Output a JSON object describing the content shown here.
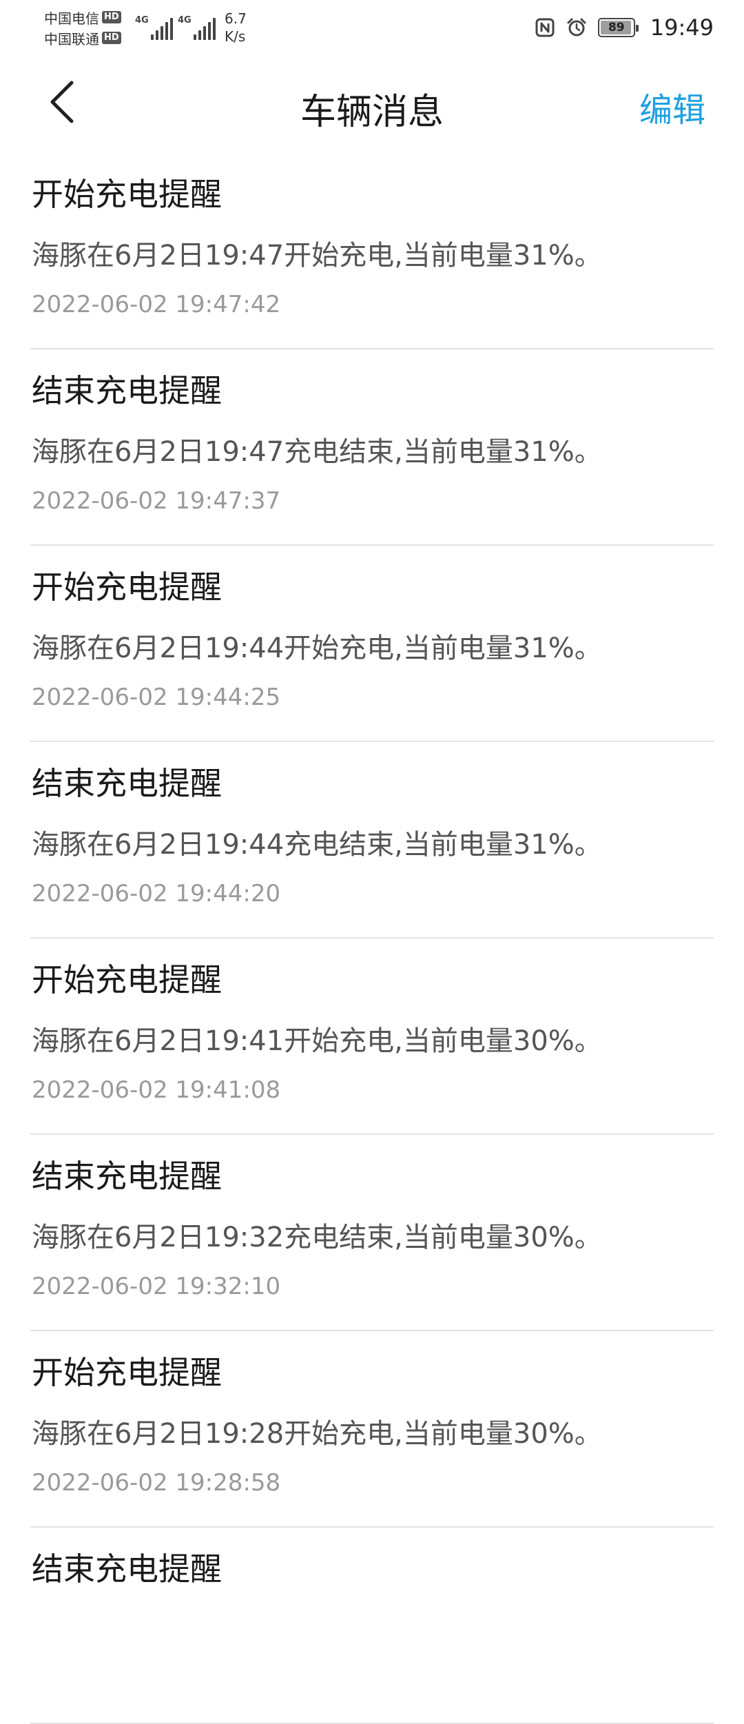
{
  "status_bar": {
    "carrier_1": "中国电信",
    "carrier_2": "中国联通",
    "hd_badge": "HD",
    "network_1": "4G",
    "network_2": "4G",
    "speed_value": "6.7",
    "speed_unit": "K/s",
    "battery_level": "89",
    "time": "19:49"
  },
  "header": {
    "title": "车辆消息",
    "edit_label": "编辑"
  },
  "messages": [
    {
      "title": "开始充电提醒",
      "body": "海豚在6月2日19:47开始充电,当前电量31%。",
      "time": "2022-06-02 19:47:42"
    },
    {
      "title": "结束充电提醒",
      "body": "海豚在6月2日19:47充电结束,当前电量31%。",
      "time": "2022-06-02 19:47:37"
    },
    {
      "title": "开始充电提醒",
      "body": "海豚在6月2日19:44开始充电,当前电量31%。",
      "time": "2022-06-02 19:44:25"
    },
    {
      "title": "结束充电提醒",
      "body": "海豚在6月2日19:44充电结束,当前电量31%。",
      "time": "2022-06-02 19:44:20"
    },
    {
      "title": "开始充电提醒",
      "body": "海豚在6月2日19:41开始充电,当前电量30%。",
      "time": "2022-06-02 19:41:08"
    },
    {
      "title": "结束充电提醒",
      "body": "海豚在6月2日19:32充电结束,当前电量30%。",
      "time": "2022-06-02 19:32:10"
    },
    {
      "title": "开始充电提醒",
      "body": "海豚在6月2日19:28开始充电,当前电量30%。",
      "time": "2022-06-02 19:28:58"
    },
    {
      "title": "结束充电提醒",
      "body": "",
      "time": ""
    }
  ]
}
